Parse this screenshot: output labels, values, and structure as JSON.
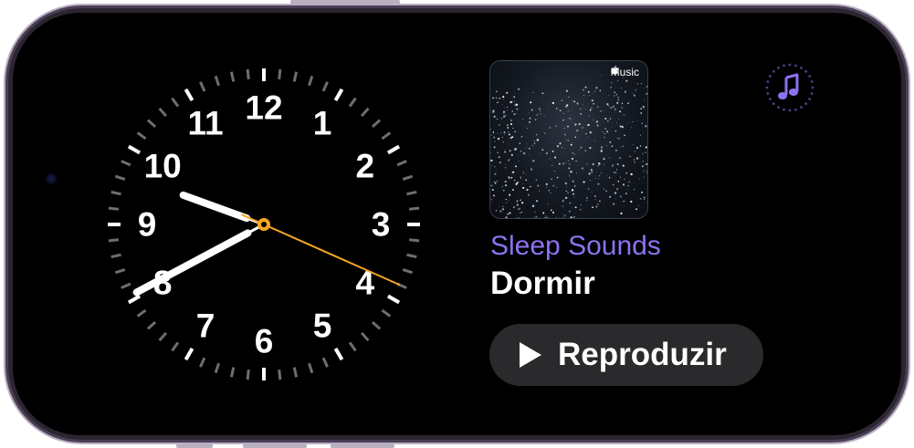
{
  "clock": {
    "hour_numerals": [
      "12",
      "1",
      "2",
      "3",
      "4",
      "5",
      "6",
      "7",
      "8",
      "9",
      "10",
      "11"
    ],
    "time": {
      "hours": 9,
      "minutes": 40,
      "seconds": 19
    },
    "hand_color": "#ffffff",
    "second_hand_color": "#f5a623"
  },
  "now_playing": {
    "service_badge": "Music",
    "title": "Sleep Sounds",
    "subtitle": "Dormir",
    "play_label": "Reproduzir",
    "title_color": "#8c72f0"
  },
  "icons": {
    "widget": "music-note-icon",
    "play": "play-icon"
  }
}
